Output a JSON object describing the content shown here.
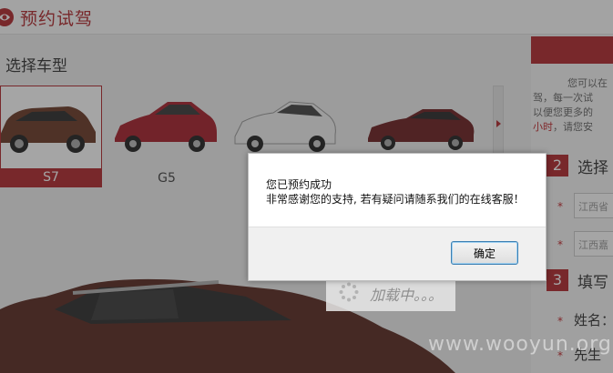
{
  "header": {
    "title": "预约试驾"
  },
  "section": {
    "title": "选择车型"
  },
  "cars": [
    {
      "label": "S7",
      "selected": true
    },
    {
      "label": "G5",
      "selected": false
    },
    {
      "label": "",
      "selected": false
    },
    {
      "label": "",
      "selected": false
    }
  ],
  "right": {
    "intro_line1": "您可以在",
    "intro_line2": "驾，每一次试",
    "intro_line3": "以便您更多的",
    "intro_hl": "小时",
    "intro_line4": "，请您安",
    "step2": {
      "num": "2",
      "title": "选择"
    },
    "province": "江西省",
    "city": "江西嘉",
    "step3": {
      "num": "3",
      "title": "填写"
    },
    "name_label": "姓名：",
    "gender_label": "先生"
  },
  "loading": {
    "text": "加载中。。。"
  },
  "dialog": {
    "message_line1": "您已预约成功",
    "message_line2": "非常感谢您的支持, 若有疑问请随系我们的在线客服！",
    "ok_label": "确定"
  },
  "watermark": "www.wooyun.org",
  "colors": {
    "brand": "#b1282d",
    "overlay": "rgba(40,40,40,0.42)"
  }
}
